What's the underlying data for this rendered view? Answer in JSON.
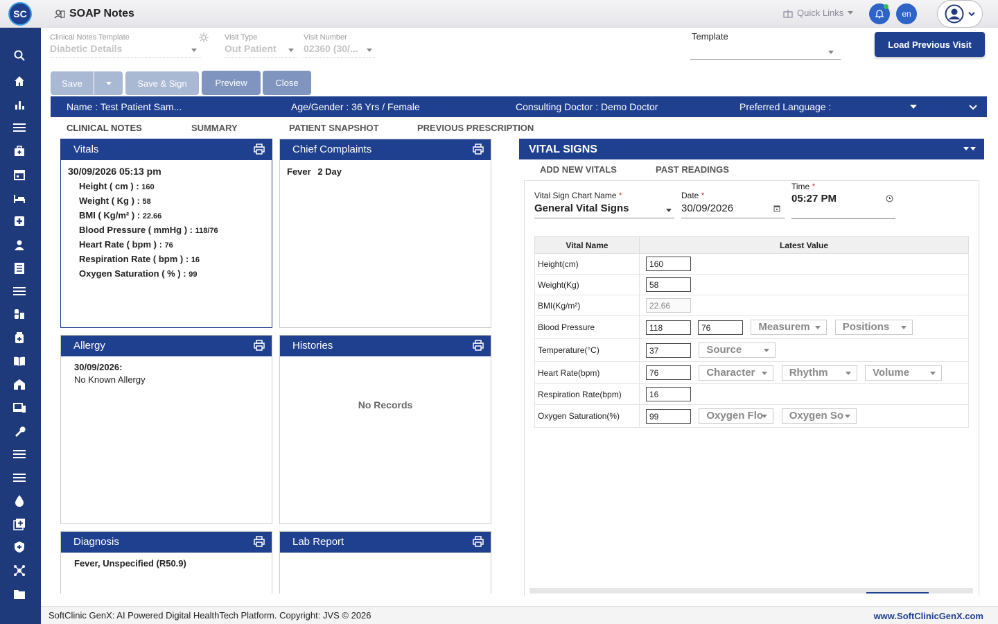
{
  "header": {
    "logo_text": "SC",
    "app_title": "SOAP Notes",
    "quick_links": "Quick Links",
    "lang": "en"
  },
  "form": {
    "template_label": "Clinical Notes Template",
    "template_value": "Diabetic Details",
    "visit_type_label": "Visit Type",
    "visit_type_value": "Out Patient",
    "visit_number_label": "Visit Number",
    "visit_number_value": "02360 (30/...",
    "template2_label": "Template",
    "template2_value": "",
    "load_previous": "Load Previous Visit"
  },
  "toolbar": {
    "save": "Save",
    "save_sign": "Save & Sign",
    "preview": "Preview",
    "close": "Close"
  },
  "patient": {
    "name": "Name :  Test Patient Sam...",
    "age_gender": "Age/Gender :  36 Yrs / Female",
    "doctor": "Consulting Doctor :  Demo Doctor",
    "language": "Preferred Language :"
  },
  "tabs": [
    "CLINICAL NOTES",
    "SUMMARY",
    "PATIENT SNAPSHOT",
    "PREVIOUS PRESCRIPTION"
  ],
  "cards": {
    "vitals": {
      "title": "Vitals",
      "timestamp": "30/09/2026 05:13 pm",
      "rows": [
        {
          "label": "Height ( cm ) :",
          "value": "160"
        },
        {
          "label": "Weight ( Kg ) :",
          "value": "58"
        },
        {
          "label": "BMI ( Kg/m² ) :",
          "value": "22.66"
        },
        {
          "label": "Blood Pressure ( mmHg ) :",
          "value": "118/76"
        },
        {
          "label": "Heart Rate ( bpm ) :",
          "value": "76"
        },
        {
          "label": "Respiration Rate ( bpm ) :",
          "value": "16"
        },
        {
          "label": "Oxygen Saturation ( % ) :",
          "value": "99"
        }
      ]
    },
    "chief": {
      "title": "Chief Complaints",
      "complaint": "Fever",
      "duration": "2 Day"
    },
    "allergy": {
      "title": "Allergy",
      "date": "30/09/2026:",
      "text": "No Known Allergy"
    },
    "histories": {
      "title": "Histories",
      "empty": "No Records"
    },
    "diagnosis": {
      "title": "Diagnosis",
      "text": "Fever, Unspecified (R50.9)"
    },
    "lab": {
      "title": "Lab Report"
    }
  },
  "vital_signs": {
    "title": "VITAL SIGNS",
    "tab_add": "ADD NEW VITALS",
    "tab_past": "PAST READINGS",
    "chart_label": "Vital Sign Chart Name",
    "chart_value": "General Vital Signs",
    "date_label": "Date",
    "date_value": "30/09/2026",
    "time_label": "Time",
    "time_value": "05:27  PM",
    "col_name": "Vital Name",
    "col_value": "Latest Value",
    "rows": {
      "height": {
        "name": "Height(cm)",
        "value": "160"
      },
      "weight": {
        "name": "Weight(Kg)",
        "value": "58"
      },
      "bmi": {
        "name": "BMI(Kg/m²)",
        "value": "22.66"
      },
      "bp": {
        "name": "Blood Pressure",
        "sys": "118",
        "dia": "76",
        "measurement": "Measurem",
        "positions": "Positions"
      },
      "temp": {
        "name": "Temperature(°C)",
        "value": "37",
        "source": "Source"
      },
      "hr": {
        "name": "Heart Rate(bpm)",
        "value": "76",
        "character": "Character",
        "rhythm": "Rhythm",
        "volume": "Volume"
      },
      "rr": {
        "name": "Respiration Rate(bpm)",
        "value": "16"
      },
      "spo2": {
        "name": "Oxygen Saturation(%)",
        "value": "99",
        "flow": "Oxygen Flo",
        "source": "Oxygen So"
      }
    }
  },
  "footer": {
    "left": "SoftClinic GenX: AI Powered Digital HealthTech Platform. Copyright: JVS © 2026",
    "right": "www.SoftClinicGenX.com"
  },
  "colors": {
    "primary": "#1f3f8f",
    "sidebar": "#1f3a7a",
    "accent": "#2e64c8"
  }
}
